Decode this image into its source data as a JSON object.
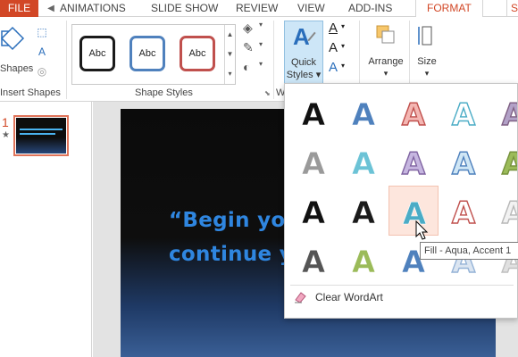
{
  "tabs": {
    "file": "FILE",
    "scroll_left": "◀",
    "items": [
      "ANIMATIONS",
      "SLIDE SHOW",
      "REVIEW",
      "VIEW",
      "ADD-INS",
      "FORMAT",
      "Si"
    ]
  },
  "ribbon": {
    "insert_shapes": {
      "button_label": "Shapes",
      "group_label": "Insert Shapes"
    },
    "shape_styles": {
      "group_label": "Shape Styles",
      "thumbnails": [
        {
          "label": "Abc",
          "border_color": "#1a1a1a"
        },
        {
          "label": "Abc",
          "border_color": "#4f81bd"
        },
        {
          "label": "Abc",
          "border_color": "#c0504d"
        }
      ]
    },
    "quick_styles": {
      "line1": "Quick",
      "line2": "Styles ▾"
    },
    "wordart_group_label": "W",
    "arrange": {
      "label": "Arrange",
      "arrow": "▾"
    },
    "size": {
      "label": "Size",
      "arrow": "▾"
    }
  },
  "thumbnails_pane": {
    "slide_number": "1",
    "star": "★"
  },
  "slide": {
    "line1": "“Begin your to",
    "line2": "continue you"
  },
  "wordart_gallery": {
    "tooltip": "Fill - Aqua, Accent 1",
    "clear_label": "Clear WordArt",
    "selected_index": 12,
    "styles": [
      {
        "fill": "#111111",
        "stroke": "#ffffff",
        "name": "black-fill"
      },
      {
        "fill": "#4f81bd",
        "stroke": "#ffffff",
        "name": "blue-fill"
      },
      {
        "fill": "#f4b6b2",
        "stroke": "#c0504d",
        "name": "red-outline-fill"
      },
      {
        "fill": "#ffffff",
        "stroke": "#4bacc6",
        "name": "aqua-outline"
      },
      {
        "fill": "#b2a1c7",
        "stroke": "#7f6084",
        "name": "purple-fill"
      },
      {
        "fill": "#9a9a9a",
        "stroke": "#ffffff",
        "name": "gray-gradient"
      },
      {
        "fill": "#6cc3d6",
        "stroke": "#ffffff",
        "name": "aqua-gradient"
      },
      {
        "fill": "#c6b6e0",
        "stroke": "#8064a2",
        "name": "lavender-fill"
      },
      {
        "fill": "#cfe6f5",
        "stroke": "#4f81bd",
        "name": "light-blue-outline"
      },
      {
        "fill": "#9bbb59",
        "stroke": "#76923c",
        "name": "green-gradient"
      },
      {
        "fill": "#111111",
        "stroke": "#ffffff",
        "name": "black-shadow"
      },
      {
        "fill": "#1a1a1a",
        "stroke": "#ffffff",
        "name": "black-reflection"
      },
      {
        "fill": "#4bacc6",
        "stroke": "#ffffff",
        "name": "aqua-fill"
      },
      {
        "fill": "#ffffff",
        "stroke": "#c0504d",
        "name": "red-outline"
      },
      {
        "fill": "#f2f2f2",
        "stroke": "#b8b8b8",
        "name": "silver-outline"
      },
      {
        "fill": "#555555",
        "stroke": "#ffffff",
        "name": "striped-gray"
      },
      {
        "fill": "#9bbb59",
        "stroke": "#ffffff",
        "name": "striped-green"
      },
      {
        "fill": "#4f81bd",
        "stroke": "#ffffff",
        "name": "striped-blue"
      },
      {
        "fill": "#dbe5f1",
        "stroke": "#95b3d7",
        "name": "pale-blue"
      },
      {
        "fill": "#e0e0e0",
        "stroke": "#c0c0c0",
        "name": "pale-gray"
      }
    ]
  },
  "colors": {
    "accent": "#d24726",
    "slide_text": "#2f86e0",
    "selection": "#fde6dd"
  }
}
